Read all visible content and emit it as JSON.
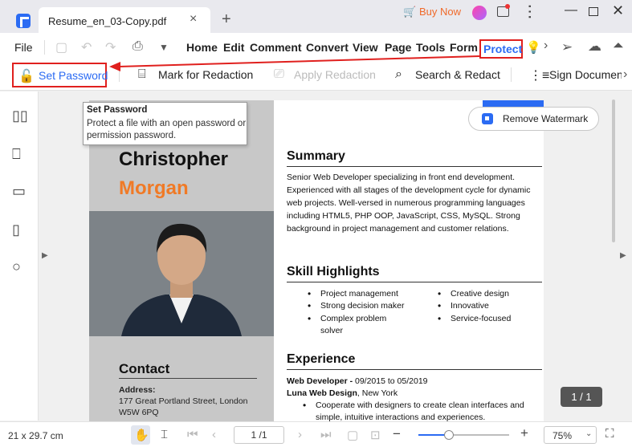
{
  "titlebar": {
    "tab_title": "Resume_en_03-Copy.pdf",
    "buy_now": "Buy Now"
  },
  "menubar": {
    "file": "File",
    "items": [
      "Home",
      "Edit",
      "Comment",
      "Convert",
      "View",
      "Page",
      "Tools",
      "Form"
    ],
    "active": "Protect"
  },
  "ribbon": {
    "set_password": "Set Password",
    "mark_for_redaction": "Mark for Redaction",
    "apply_redaction": "Apply Redaction",
    "search_redact": "Search & Redact",
    "sign_document": "Sign Documen"
  },
  "tooltip": {
    "title": "Set Password",
    "body": "Protect a file with an open password or permission password."
  },
  "watermark_button": "Remove Watermark",
  "resume": {
    "first_name": "Christopher",
    "last_name": "Morgan",
    "contact_title": "Contact",
    "address_label": "Address:",
    "address_line1": "177 Great Portland Street, London",
    "address_line2": "W5W 6PQ",
    "summary_title": "Summary",
    "summary_text": "Senior Web Developer specializing in front end development. Experienced with all stages of the development cycle for dynamic web projects. Well-versed in numerous programming languages including HTML5, PHP OOP, JavaScript, CSS, MySQL. Strong background in project management and customer relations.",
    "skills_title": "Skill Highlights",
    "skills_left": [
      "Project management",
      "Strong decision maker",
      "Complex problem solver"
    ],
    "skills_right": [
      "Creative design",
      "Innovative",
      "Service-focused"
    ],
    "experience_title": "Experience",
    "job_title": "Web Developer - ",
    "job_dates": "09/2015 to 05/2019",
    "company": "Luna Web Design",
    "company_location": ", New York",
    "job_bullet": "Cooperate with designers to create clean interfaces and simple, intuitive interactions and experiences."
  },
  "page_badge": "1 / 1",
  "statusbar": {
    "page_size": "21 x 29.7 cm",
    "page_input": "1 /1",
    "zoom": "75%"
  },
  "colors": {
    "accent": "#2b6bf3",
    "highlight_box": "#e0201e",
    "name_orange": "#f07a26"
  }
}
